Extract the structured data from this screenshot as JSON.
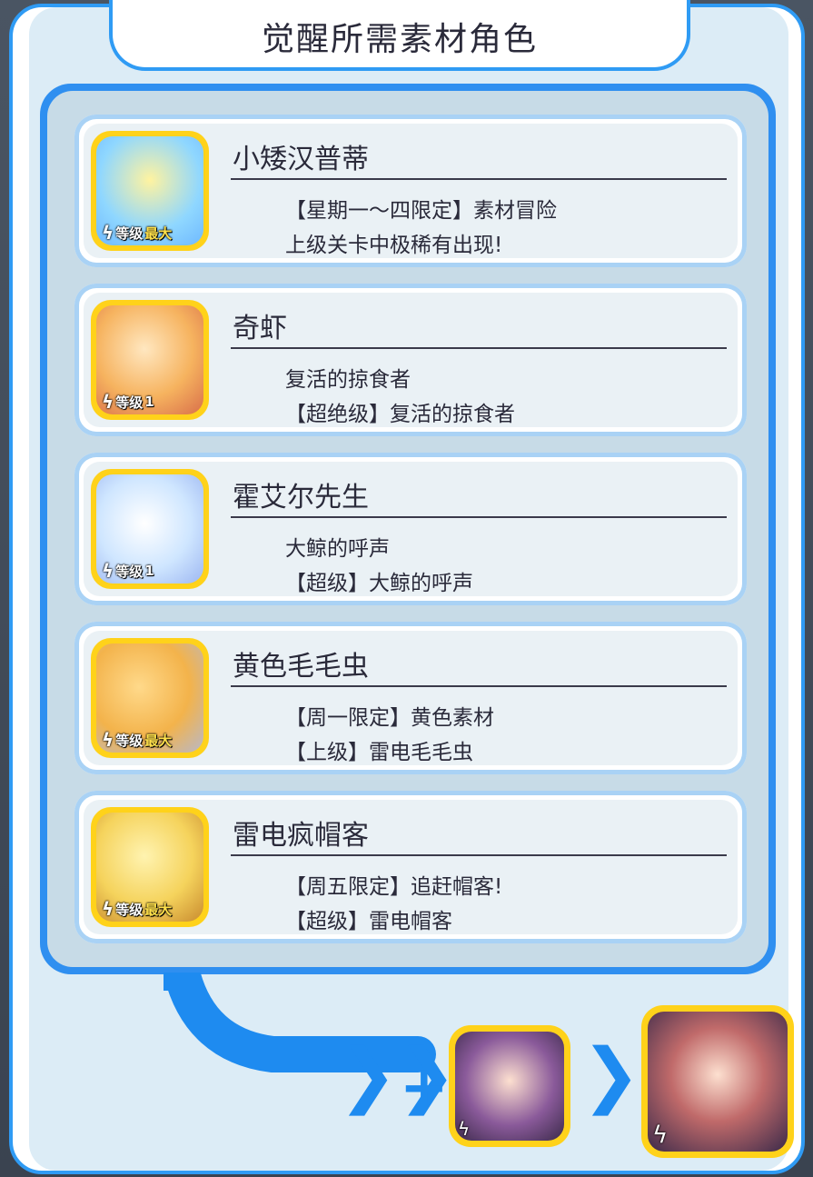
{
  "title": "觉醒所需素材角色",
  "items": [
    {
      "name": "小矮汉普蒂",
      "line1": "【星期一～四限定】素材冒险",
      "line2": "上级关卡中极稀有出现!",
      "level_label": "等级",
      "level_value": "最大",
      "art": "#8fd7ff"
    },
    {
      "name": "奇虾",
      "line1": "复活的掠食者",
      "line2": "【超绝级】复活的掠食者",
      "level_label": "等级",
      "level_value": "1",
      "art": "#f6b35f"
    },
    {
      "name": "霍艾尔先生",
      "line1": "大鲸的呼声",
      "line2": "【超级】大鲸的呼声",
      "level_label": "等级",
      "level_value": "1",
      "art": "#cfe6ff"
    },
    {
      "name": "黄色毛毛虫",
      "line1": "【周一限定】黄色素材",
      "line2": "【上级】雷电毛毛虫",
      "level_label": "等级",
      "level_value": "最大",
      "art": "#f3b34b"
    },
    {
      "name": "雷电疯帽客",
      "line1": "【周五限定】追赶帽客!",
      "line2": "【超级】雷电帽客",
      "level_label": "等级",
      "level_value": "最大",
      "art": "#f5d35c"
    }
  ],
  "colors": {
    "accent": "#2f8ff0",
    "gold": "#ffd21a"
  },
  "icons": {
    "level": "lightning-icon",
    "plus": "plus-icon",
    "arrow": "chevron-right-icon"
  }
}
